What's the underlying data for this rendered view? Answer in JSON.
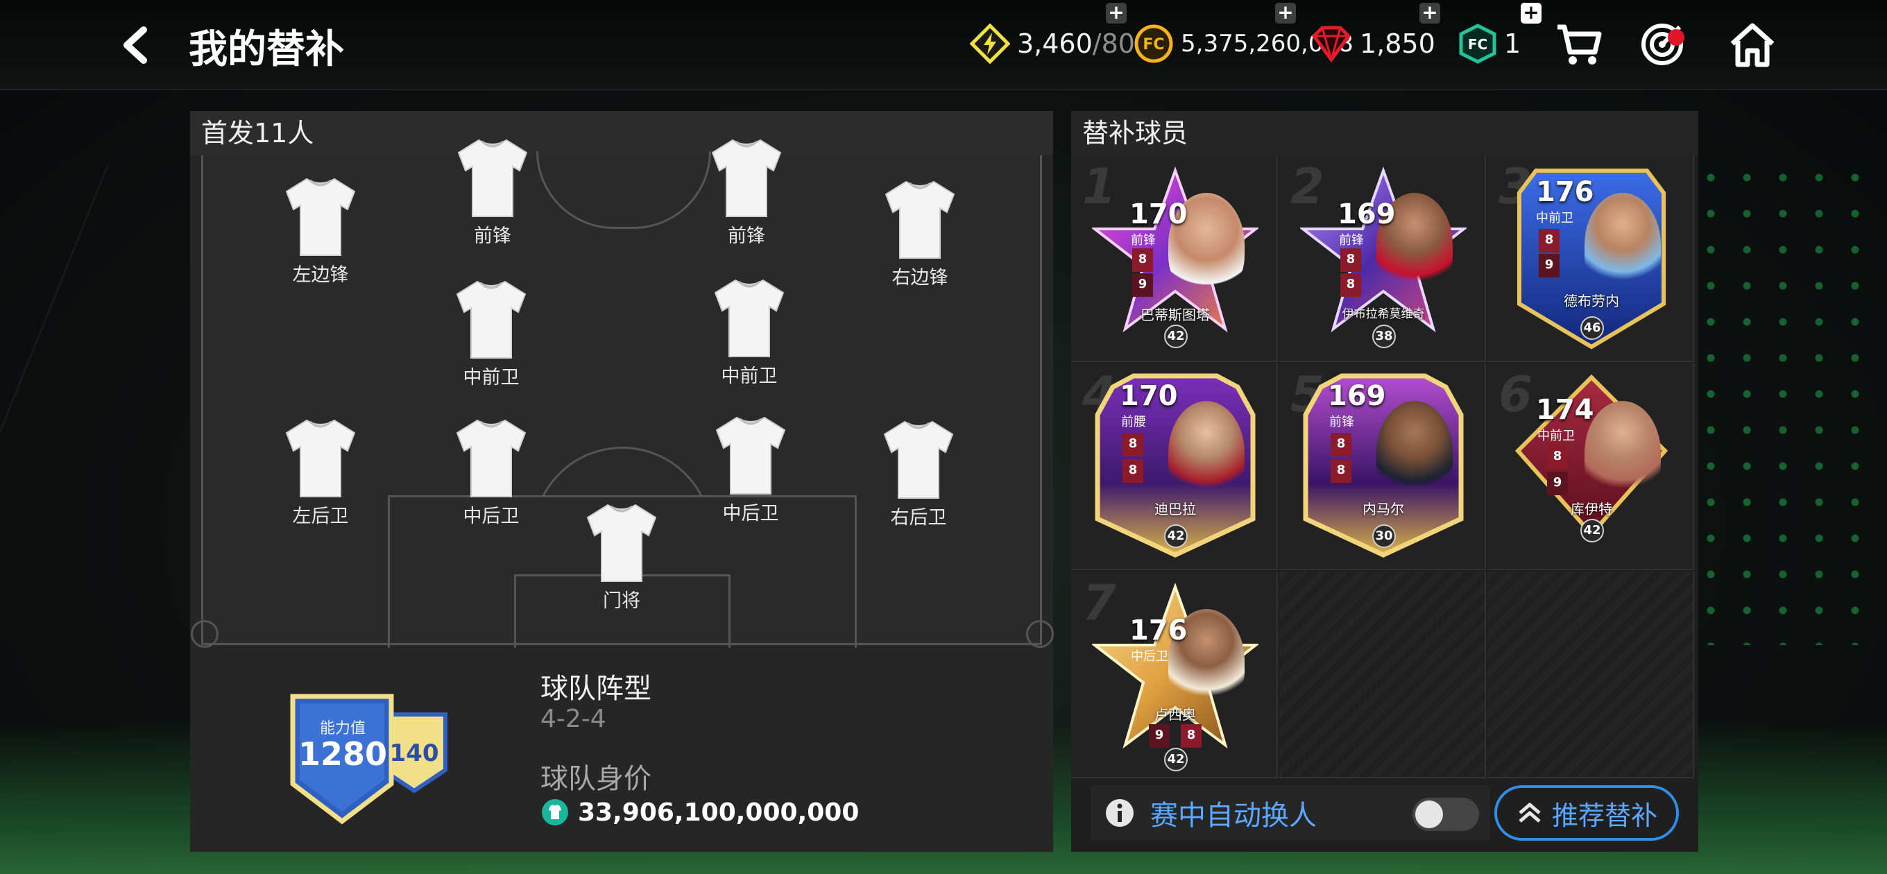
{
  "header": {
    "title": "我的替补",
    "currencies": [
      {
        "icon": "energy-icon",
        "value": "3,460",
        "max": "/80"
      },
      {
        "icon": "fc-coin-icon",
        "value": "5,375,260,088"
      },
      {
        "icon": "gem-icon",
        "value": "1,850"
      },
      {
        "icon": "fc-token-icon",
        "value": "1"
      }
    ]
  },
  "lineup": {
    "title": "首发11人",
    "positions": {
      "lw": "左边锋",
      "st1": "前锋",
      "st2": "前锋",
      "rw": "右边锋",
      "cm1": "中前卫",
      "cm2": "中前卫",
      "lb": "左后卫",
      "cb1": "中后卫",
      "cb2": "中后卫",
      "rb": "右后卫",
      "gk": "门将"
    },
    "rating_label": "能力值",
    "rating_value": "1280",
    "sub_rating": "140",
    "formation_label": "球队阵型",
    "formation_value": "4-2-4",
    "team_value_label": "球队身价",
    "team_value": "33,906,100,000,000"
  },
  "bench": {
    "title": "替补球员",
    "players": [
      {
        "slot": "1",
        "ovr": "170",
        "pos": "前锋",
        "name": "巴蒂斯图塔",
        "level": "42",
        "b1": "8",
        "b2": "9"
      },
      {
        "slot": "2",
        "ovr": "169",
        "pos": "前锋",
        "name": "伊布拉希莫维奇",
        "level": "38",
        "b1": "8",
        "b2": "8"
      },
      {
        "slot": "3",
        "ovr": "176",
        "pos": "中前卫",
        "name": "德布劳内",
        "level": "46",
        "b1": "8",
        "b2": "9"
      },
      {
        "slot": "4",
        "ovr": "170",
        "pos": "前腰",
        "name": "迪巴拉",
        "level": "42",
        "b1": "8",
        "b2": "8"
      },
      {
        "slot": "5",
        "ovr": "169",
        "pos": "前锋",
        "name": "内马尔",
        "level": "30",
        "b1": "8",
        "b2": "8"
      },
      {
        "slot": "6",
        "ovr": "174",
        "pos": "中前卫",
        "name": "库伊特",
        "level": "42",
        "b1": "8",
        "b2": "9"
      },
      {
        "slot": "7",
        "ovr": "176",
        "pos": "中后卫",
        "name": "卢西奥",
        "level": "42",
        "b1": "9",
        "b2": "8"
      }
    ],
    "auto_sub_label": "赛中自动换人",
    "auto_sub_on": false,
    "recommend_label": "推荐替补"
  },
  "colors": {
    "accent_blue": "#2f8ee8",
    "toggle_off": "#444444"
  }
}
